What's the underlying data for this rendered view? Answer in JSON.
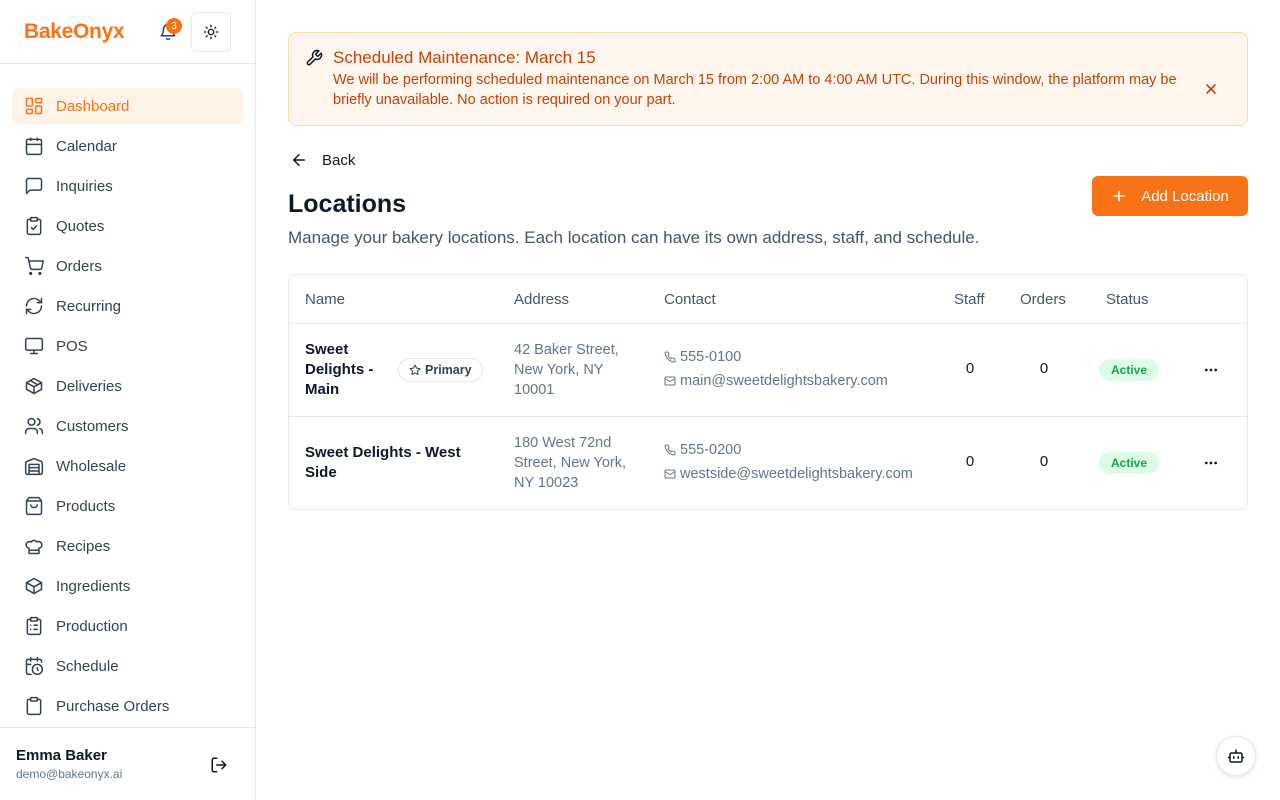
{
  "app": {
    "logo": "BakeOnyx",
    "notification_count": "3"
  },
  "sidebar": {
    "items": [
      {
        "label": "Dashboard",
        "icon": "grid-icon",
        "active": true
      },
      {
        "label": "Calendar",
        "icon": "calendar-icon"
      },
      {
        "label": "Inquiries",
        "icon": "message-icon"
      },
      {
        "label": "Quotes",
        "icon": "clipboard-check-icon"
      },
      {
        "label": "Orders",
        "icon": "cart-icon"
      },
      {
        "label": "Recurring",
        "icon": "refresh-icon"
      },
      {
        "label": "POS",
        "icon": "monitor-icon"
      },
      {
        "label": "Deliveries",
        "icon": "package-icon"
      },
      {
        "label": "Customers",
        "icon": "users-icon"
      },
      {
        "label": "Wholesale",
        "icon": "warehouse-icon"
      },
      {
        "label": "Products",
        "icon": "shopping-bag-icon"
      },
      {
        "label": "Recipes",
        "icon": "chef-hat-icon"
      },
      {
        "label": "Ingredients",
        "icon": "box-icon"
      },
      {
        "label": "Production",
        "icon": "clipboard-list-icon"
      },
      {
        "label": "Schedule",
        "icon": "calendar-clock-icon"
      },
      {
        "label": "Purchase Orders",
        "icon": "clipboard-icon"
      }
    ]
  },
  "user": {
    "name": "Emma Baker",
    "email": "demo@bakeonyx.ai"
  },
  "alert": {
    "title": "Scheduled Maintenance: March 15",
    "body": "We will be performing scheduled maintenance on March 15 from 2:00 AM to 4:00 AM UTC. During this window, the platform may be briefly unavailable. No action is required on your part."
  },
  "page": {
    "back_label": "Back",
    "title": "Locations",
    "description": "Manage your bakery locations. Each location can have its own address, staff, and schedule.",
    "add_button": "Add Location"
  },
  "table": {
    "headers": [
      "Name",
      "Address",
      "Contact",
      "Staff",
      "Orders",
      "Status"
    ],
    "rows": [
      {
        "name": "Sweet Delights - Main",
        "badge": "Primary",
        "address": "42 Baker Street, New York, NY 10001",
        "phone": "555-0100",
        "email": "main@sweetdelightsbakery.com",
        "staff": "0",
        "orders": "0",
        "status": "Active"
      },
      {
        "name": "Sweet Delights - West Side",
        "badge": "",
        "address": "180 West 72nd Street, New York, NY 10023",
        "phone": "555-0200",
        "email": "westside@sweetdelightsbakery.com",
        "staff": "0",
        "orders": "0",
        "status": "Active"
      }
    ]
  },
  "colors": {
    "accent": "#f97316",
    "alert_bg": "#fff7ed",
    "status_active": "#16a34a"
  }
}
